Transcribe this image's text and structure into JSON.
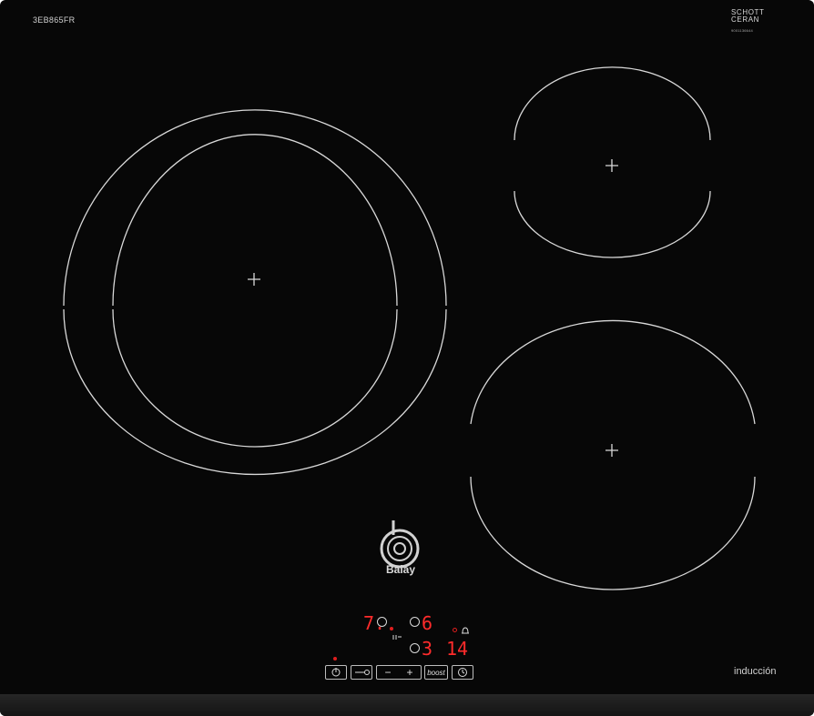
{
  "model": "3EB865FR",
  "schott": {
    "line1": "SCHOTT",
    "line2": "CERAN",
    "code": "9001136644"
  },
  "brand": "Balay",
  "induction_label": "inducción",
  "display": {
    "zone_left_level": "7.",
    "zone_rear_level": "6",
    "zone_front_level": "3",
    "timer": "14"
  },
  "controls": {
    "boost_label": "boost",
    "minus": "−",
    "plus": "+"
  },
  "colors": {
    "hob": "#070707",
    "display": "#ff2b2b",
    "lines": "#d9d9d9"
  }
}
